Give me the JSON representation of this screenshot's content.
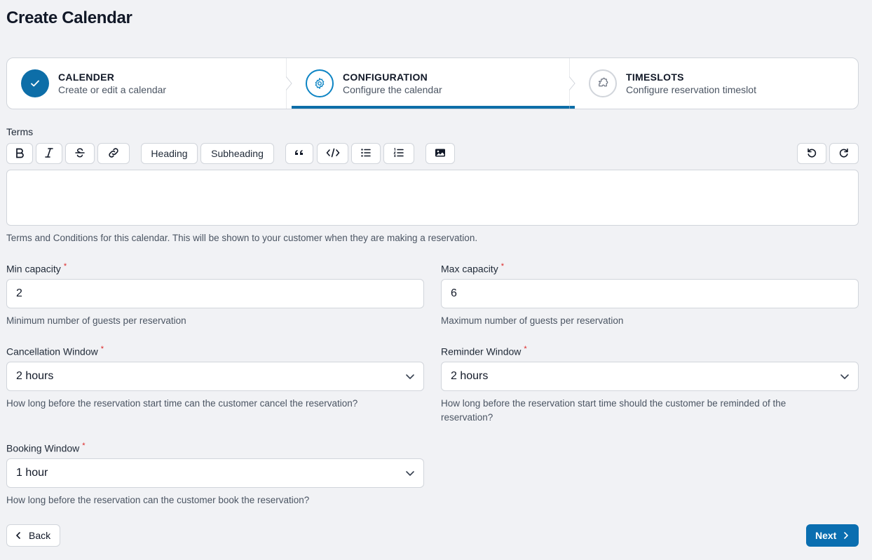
{
  "page": {
    "title": "Create Calendar"
  },
  "stepper": {
    "steps": [
      {
        "title": "CALENDER",
        "subtitle": "Create or edit a calendar",
        "status": "complete",
        "icon": "check-icon"
      },
      {
        "title": "CONFIGURATION",
        "subtitle": "Configure the calendar",
        "status": "active",
        "icon": "gear-icon"
      },
      {
        "title": "TIMESLOTS",
        "subtitle": "Configure reservation timeslot",
        "status": "upcoming",
        "icon": "puzzle-icon"
      }
    ]
  },
  "terms": {
    "label": "Terms",
    "value": "",
    "help": "Terms and Conditions for this calendar. This will be shown to your customer when they are making a reservation.",
    "toolbar": {
      "heading": "Heading",
      "subheading": "Subheading",
      "icons": [
        "bold-icon",
        "italic-icon",
        "strikethrough-icon",
        "link-icon",
        "quote-icon",
        "code-icon",
        "bullet-list-icon",
        "ordered-list-icon",
        "image-icon",
        "undo-icon",
        "redo-icon"
      ]
    }
  },
  "fields": {
    "min_capacity": {
      "label": "Min capacity",
      "value": "2",
      "help": "Minimum number of guests per reservation"
    },
    "max_capacity": {
      "label": "Max capacity",
      "value": "6",
      "help": "Maximum number of guests per reservation"
    },
    "cancellation_window": {
      "label": "Cancellation Window",
      "value": "2 hours",
      "help": "How long before the reservation start time can the customer cancel the reservation?"
    },
    "reminder_window": {
      "label": "Reminder Window",
      "value": "2 hours",
      "help": "How long before the reservation start time should the customer be reminded of the reservation?"
    },
    "booking_window": {
      "label": "Booking Window",
      "value": "1 hour",
      "help": "How long before the reservation can the customer book the reservation?"
    }
  },
  "required_marker": "*",
  "nav": {
    "back_label": "Back",
    "next_label": "Next"
  },
  "colors": {
    "primary": "#0a6eb0",
    "accent": "#0d84c4",
    "required": "#dc2626",
    "background": "#f1f2f5"
  }
}
